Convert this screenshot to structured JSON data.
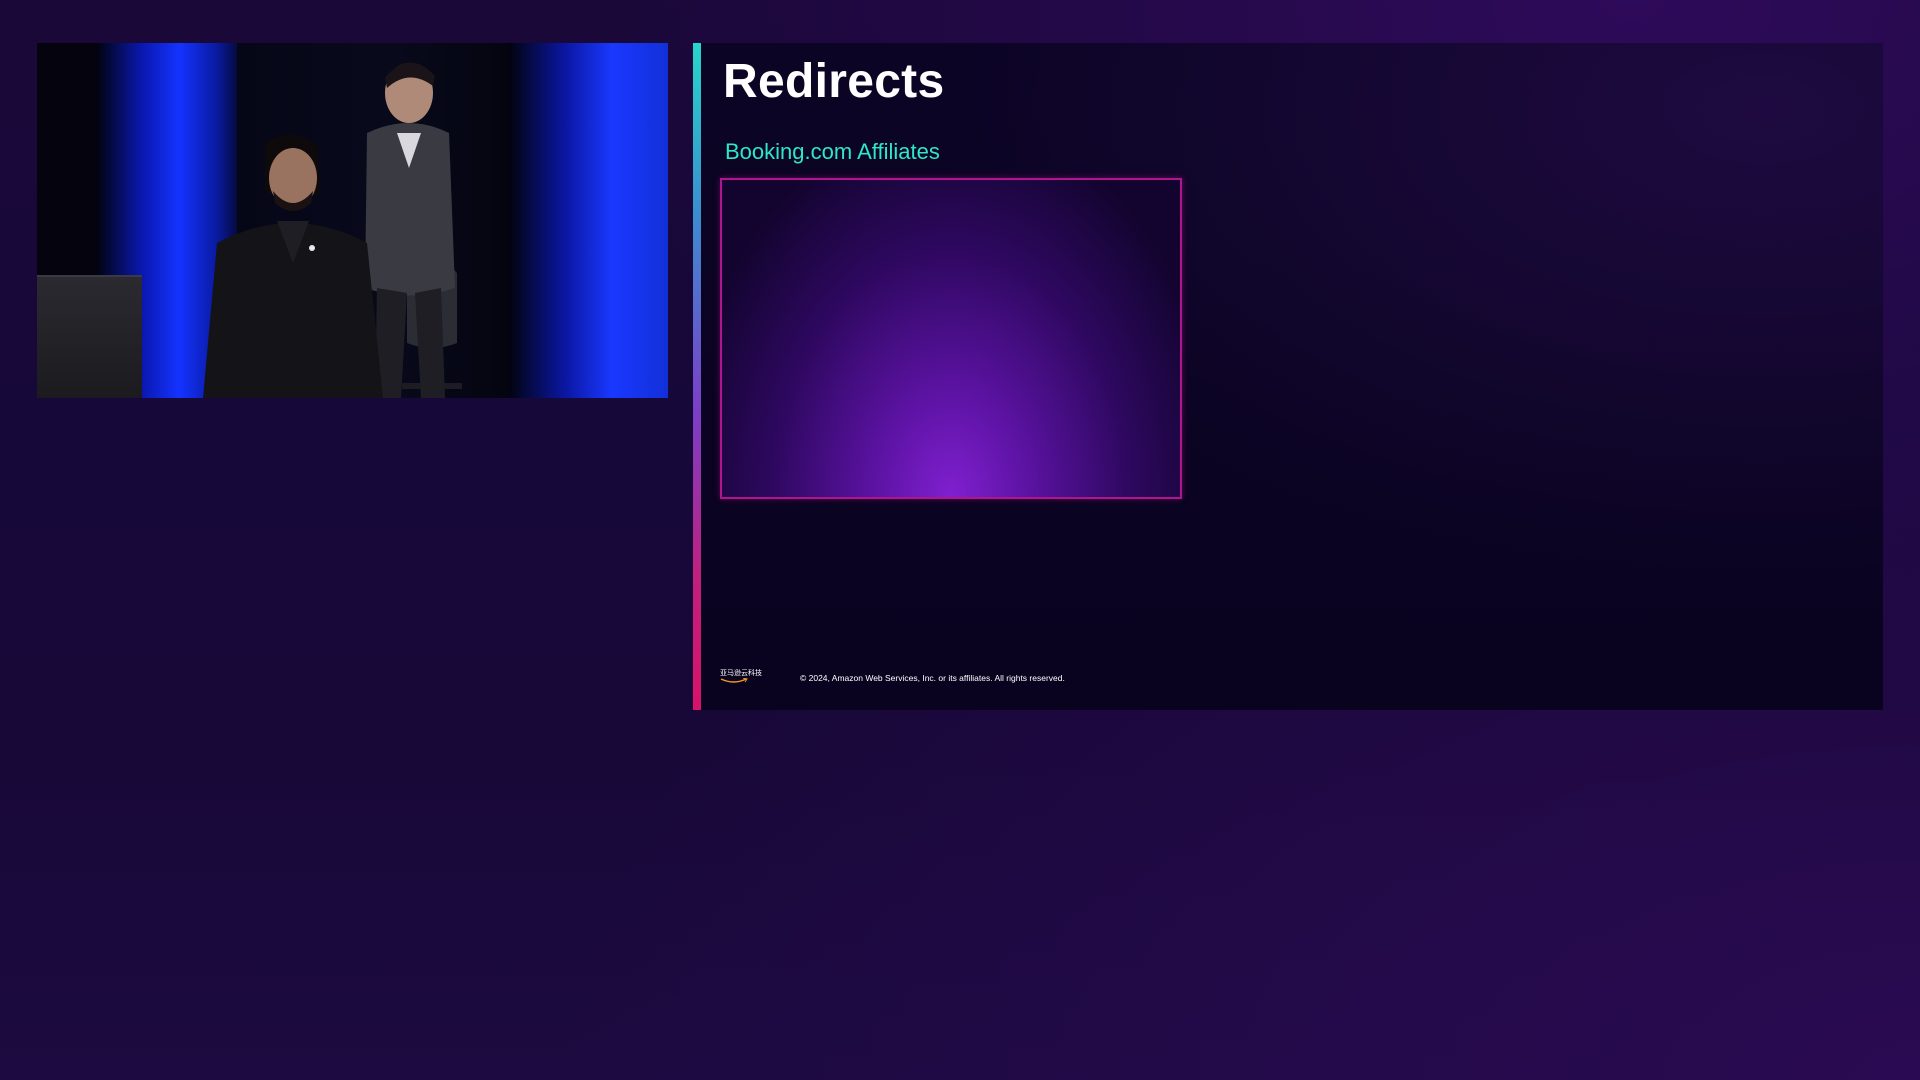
{
  "slide": {
    "title": "Redirects",
    "subtitle": "Booking.com Affiliates",
    "footer": {
      "logo_text": "亚马逊云科技",
      "copyright": "© 2024, Amazon Web Services, Inc. or its affiliates. All rights reserved."
    }
  },
  "colors": {
    "background": "#180838",
    "title": "#ffffff",
    "subtitle": "#2ee6c8",
    "media_border": "#b0148e"
  },
  "icons": {
    "logo": "amazon-smile-logo"
  }
}
